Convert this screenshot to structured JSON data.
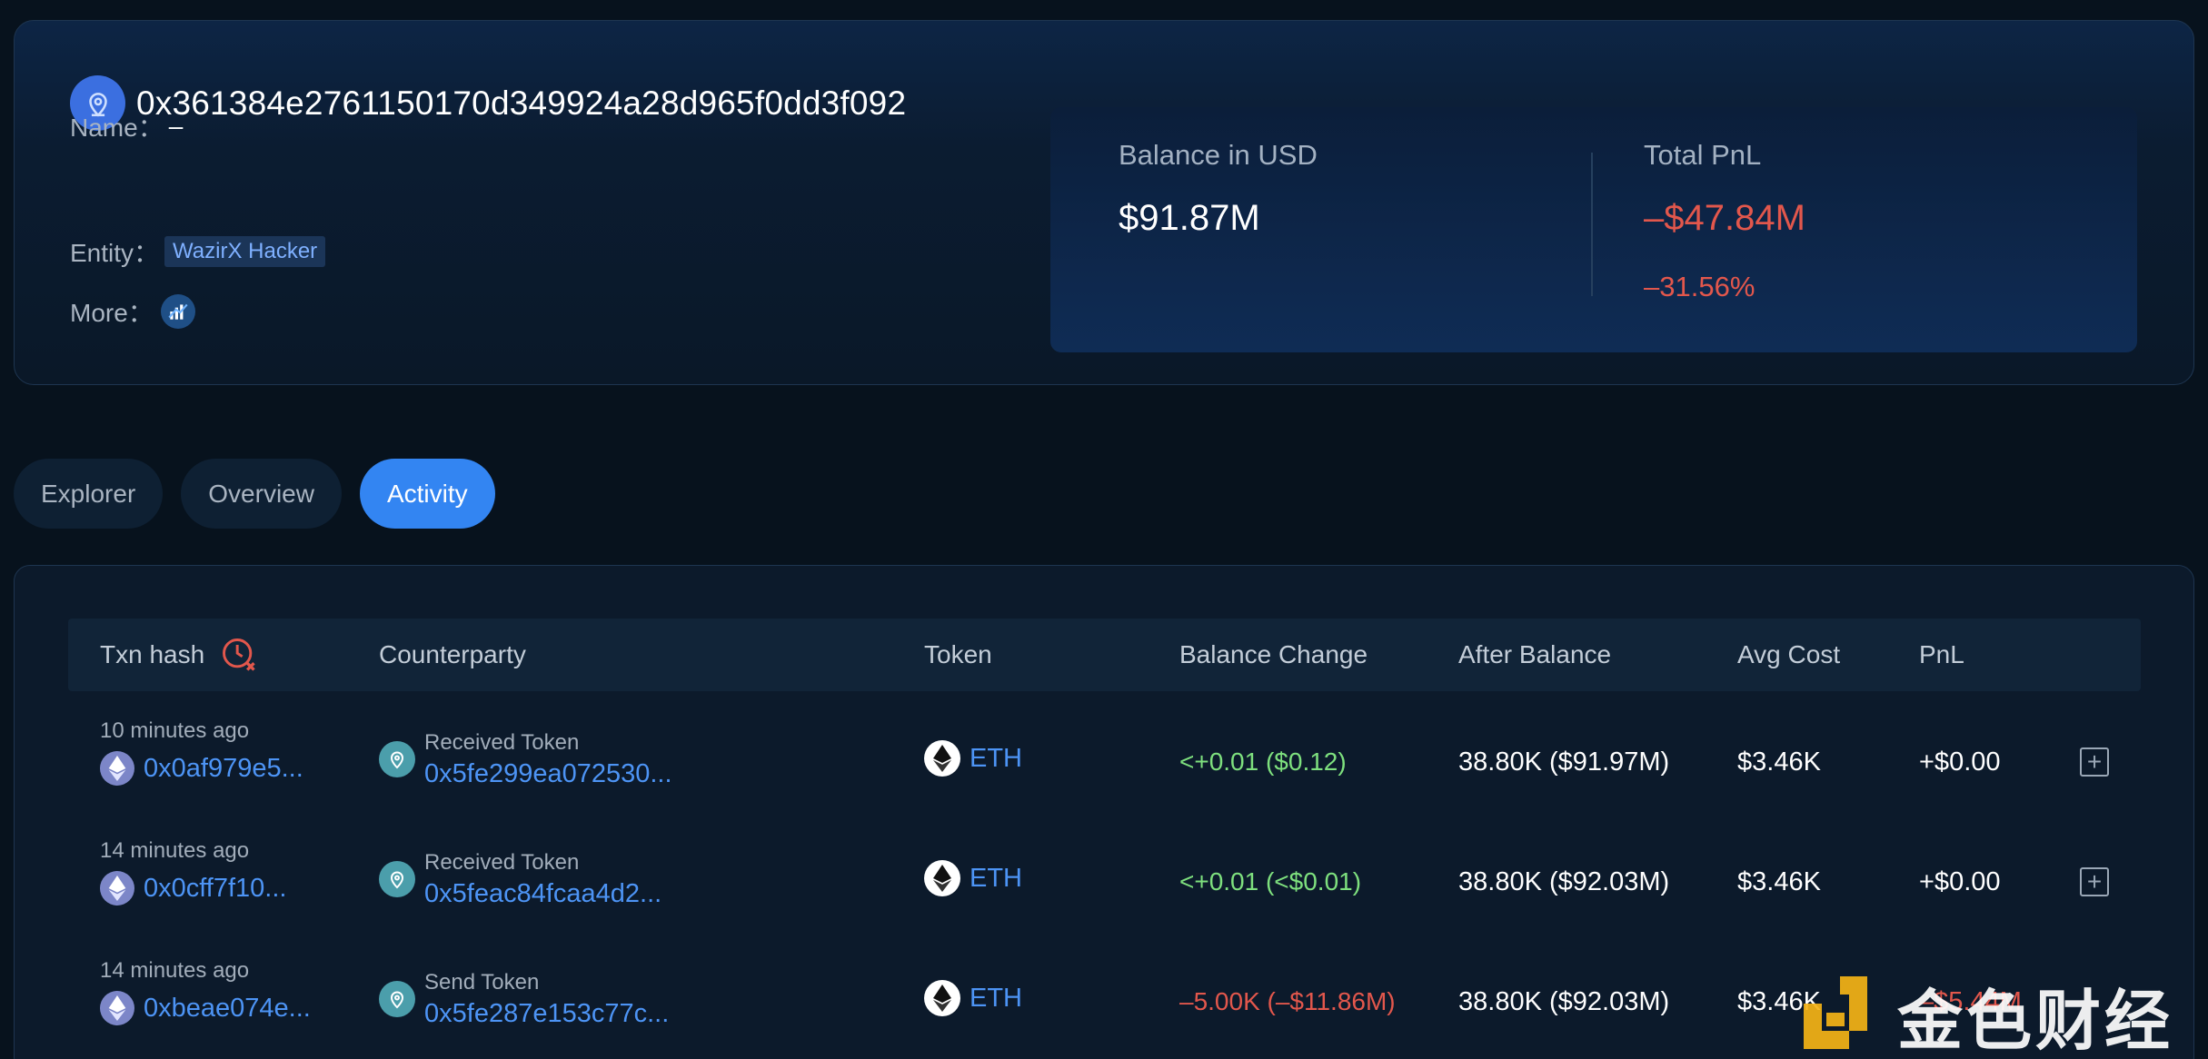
{
  "wallet": {
    "address": "0x361384e2761150170d349924a28d965f0dd3f092",
    "name_label": "Name：",
    "name_value": "–",
    "entity_label": "Entity：",
    "entity_value": "WazirX Hacker",
    "more_label": "More："
  },
  "stats": {
    "balance_label": "Balance in USD",
    "balance_value": "$91.87M",
    "pnl_label": "Total PnL",
    "pnl_value": "–$47.84M",
    "pnl_percent": "–31.56%"
  },
  "tabs": [
    {
      "label": "Explorer",
      "active": false
    },
    {
      "label": "Overview",
      "active": false
    },
    {
      "label": "Activity",
      "active": true
    }
  ],
  "table": {
    "headers": {
      "txn_hash": "Txn hash",
      "counterparty": "Counterparty",
      "token": "Token",
      "balance_change": "Balance Change",
      "after_balance": "After Balance",
      "avg_cost": "Avg Cost",
      "pnl": "PnL"
    },
    "rows": [
      {
        "time": "10 minutes ago",
        "hash": "0x0af979e5...",
        "cp_type": "Received Token",
        "cp_addr": "0x5fe299ea072530...",
        "token": "ETH",
        "change": "<+0.01 ($0.12)",
        "after": "38.80K ($91.97M)",
        "avg_cost": "$3.46K",
        "pnl": "+$0.00"
      },
      {
        "time": "14 minutes ago",
        "hash": "0x0cff7f10...",
        "cp_type": "Received Token",
        "cp_addr": "0x5feac84fcaa4d2...",
        "token": "ETH",
        "change": "<+0.01 (<$0.01)",
        "after": "38.80K ($92.03M)",
        "avg_cost": "$3.46K",
        "pnl": "+$0.00"
      },
      {
        "time": "14 minutes ago",
        "hash": "0xbeae074e...",
        "cp_type": "Send Token",
        "cp_addr": "0x5fe287e153c77c...",
        "token": "ETH",
        "change": "–5.00K (–$11.86M)",
        "after": "38.80K ($92.03M)",
        "avg_cost": "$3.46K",
        "pnl": "–$5.44M"
      }
    ]
  },
  "watermark": {
    "text": "金色财经"
  },
  "colors": {
    "accent": "#3385f2",
    "negative": "#e2574c",
    "positive": "#7ee07e",
    "link": "#4d94f5"
  }
}
